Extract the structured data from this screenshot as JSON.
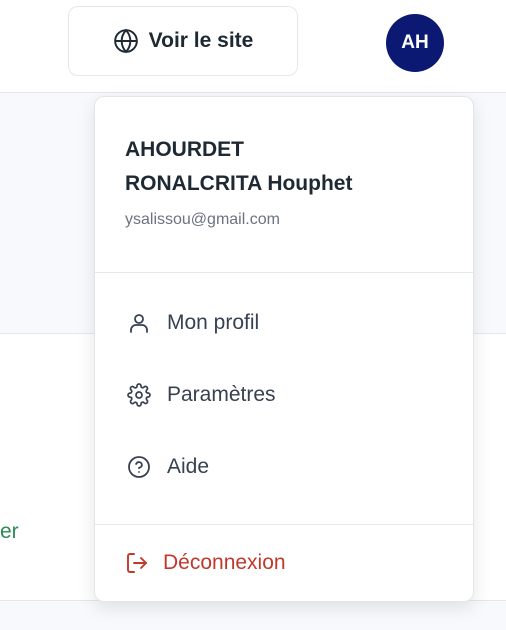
{
  "header": {
    "view_site_label": "Voir le site",
    "avatar_initials": "AH"
  },
  "background": {
    "partial_text": "er"
  },
  "user": {
    "name_line1": "AHOURDET",
    "name_line2": "RONALCRITA Houphet",
    "email": "ysalissou@gmail.com"
  },
  "menu": {
    "items": [
      {
        "label": "Mon profil",
        "icon": "user-icon"
      },
      {
        "label": "Paramètres",
        "icon": "gear-icon"
      },
      {
        "label": "Aide",
        "icon": "help-circle-icon"
      }
    ],
    "logout_label": "Déconnexion",
    "logout_icon": "logout-icon"
  },
  "colors": {
    "avatar_bg": "#0c1972",
    "logout": "#c0392b",
    "partial_text": "#2e8b57"
  }
}
